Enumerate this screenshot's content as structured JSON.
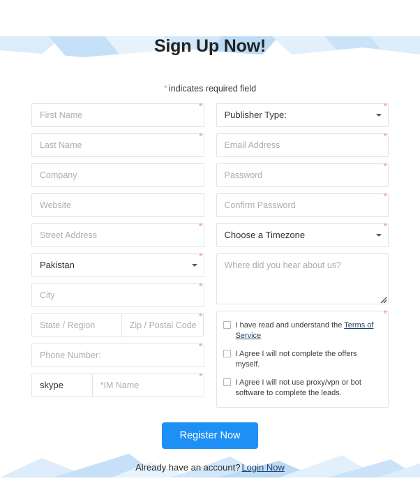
{
  "header": {
    "title": "Sign Up Now!",
    "required_note": "indicates required field",
    "required_star": "*"
  },
  "colors": {
    "accent_button": "#1e90f5",
    "required_star": "#ef9a9a",
    "link": "#24406b",
    "border": "#e3e3e3",
    "placeholder": "#aeaeae",
    "decoration": "#cfe4f7"
  },
  "form": {
    "left_column": [
      {
        "name": "first-name",
        "type": "text",
        "placeholder": "First Name",
        "value": "",
        "required": true
      },
      {
        "name": "last-name",
        "type": "text",
        "placeholder": "Last Name",
        "value": "",
        "required": true
      },
      {
        "name": "company",
        "type": "text",
        "placeholder": "Company",
        "value": "",
        "required": false
      },
      {
        "name": "website",
        "type": "text",
        "placeholder": "Website",
        "value": "",
        "required": false
      },
      {
        "name": "street-address",
        "type": "text",
        "placeholder": "Street Address",
        "value": "",
        "required": true
      },
      {
        "name": "country",
        "type": "select",
        "placeholder": "",
        "value": "Pakistan",
        "required": true
      },
      {
        "name": "city",
        "type": "text",
        "placeholder": "City",
        "value": "",
        "required": true
      },
      {
        "name": "state-region",
        "type": "text",
        "placeholder": "State / Region",
        "value": "",
        "required": false
      },
      {
        "name": "zip-postal",
        "type": "text",
        "placeholder": "Zip / Postal Code",
        "value": "",
        "required": true
      },
      {
        "name": "phone-number",
        "type": "text",
        "placeholder": "Phone Number:",
        "value": "",
        "required": true
      },
      {
        "name": "im-service",
        "type": "select",
        "placeholder": "",
        "value": "skype",
        "required": false
      },
      {
        "name": "im-name",
        "type": "text",
        "placeholder": "*IM Name",
        "value": "",
        "required": true
      }
    ],
    "right_column": [
      {
        "name": "publisher-type",
        "type": "select",
        "placeholder": "",
        "value": "Publisher Type:",
        "required": true
      },
      {
        "name": "email-address",
        "type": "text",
        "placeholder": "Email Address",
        "value": "",
        "required": true
      },
      {
        "name": "password",
        "type": "password",
        "placeholder": "Password",
        "value": "",
        "required": true
      },
      {
        "name": "confirm-password",
        "type": "password",
        "placeholder": "Confirm Password",
        "value": "",
        "required": true
      },
      {
        "name": "timezone",
        "type": "select",
        "placeholder": "",
        "value": "Choose a Timezone",
        "required": true
      },
      {
        "name": "referral-source",
        "type": "textarea",
        "placeholder": "Where did you hear about us?",
        "value": "",
        "required": false
      }
    ],
    "agreements": {
      "required": true,
      "items": [
        {
          "name": "terms-of-service",
          "checked": false,
          "text_before": "I have read and understand the ",
          "link_text": "Terms of Service",
          "text_after": ""
        },
        {
          "name": "no-self-offers",
          "checked": false,
          "text_before": "I Agree I will not complete the offers myself.",
          "link_text": "",
          "text_after": ""
        },
        {
          "name": "no-proxy-bot",
          "checked": false,
          "text_before": "I Agree I will not use proxy/vpn or bot software to complete the leads.",
          "link_text": "",
          "text_after": ""
        }
      ]
    }
  },
  "submit": {
    "label": "Register Now"
  },
  "footer": {
    "text": "Already have an account?",
    "login_link": "Login Now"
  }
}
